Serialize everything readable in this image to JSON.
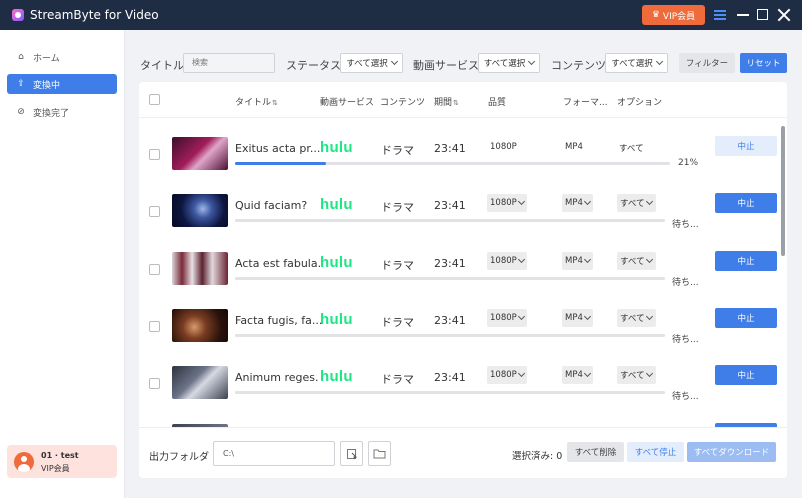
{
  "app": {
    "title": "StreamByte for Video",
    "vip_label": "VIP会員"
  },
  "sidebar": {
    "items": [
      {
        "label": "ホーム",
        "icon": "home-icon"
      },
      {
        "label": "変換中",
        "icon": "upload-icon"
      },
      {
        "label": "変換完了",
        "icon": "check-circle-icon"
      }
    ],
    "user": {
      "name": "01 · test",
      "plan": "VIP会員"
    }
  },
  "filters": {
    "title_label": "タイトル",
    "search_placeholder": "検索",
    "status_label": "ステータス",
    "status_value": "すべて選択",
    "service_label": "動画サービス",
    "service_value": "すべて選択",
    "content_label": "コンテンツ",
    "content_value": "すべて選択",
    "filter_button": "フィルター",
    "reset_button": "リセット"
  },
  "table": {
    "headers": {
      "title": "タイトル",
      "service": "動画サービス",
      "content": "コンテンツ",
      "duration": "期間",
      "quality": "品質",
      "format": "フォーマ...",
      "option": "オプション"
    },
    "rows": [
      {
        "title": "Exitus acta pr...",
        "service": "hulu",
        "content": "ドラマ",
        "duration": "23:41",
        "quality": "1080P",
        "format": "MP4",
        "option": "すべて",
        "status": "21%",
        "progress": 0.21,
        "action": "中止"
      },
      {
        "title": "Quid faciam?",
        "service": "hulu",
        "content": "ドラマ",
        "duration": "23:41",
        "quality": "1080P",
        "format": "MP4",
        "option": "すべて",
        "status": "待ち...",
        "progress": 0,
        "action": "中止"
      },
      {
        "title": "Acta est fabula.",
        "service": "hulu",
        "content": "ドラマ",
        "duration": "23:41",
        "quality": "1080P",
        "format": "MP4",
        "option": "すべて",
        "status": "待ち...",
        "progress": 0,
        "action": "中止"
      },
      {
        "title": "Facta fugis, fa...",
        "service": "hulu",
        "content": "ドラマ",
        "duration": "23:41",
        "quality": "1080P",
        "format": "MP4",
        "option": "すべて",
        "status": "待ち...",
        "progress": 0,
        "action": "中止"
      },
      {
        "title": "Animum reges.",
        "service": "hulu",
        "content": "ドラマ",
        "duration": "23:41",
        "quality": "1080P",
        "format": "MP4",
        "option": "すべて",
        "status": "待ち...",
        "progress": 0,
        "action": "中止"
      }
    ]
  },
  "footer": {
    "output_label": "出力フォルダ",
    "output_path": "C:\\",
    "selected_label": "選択済み: 0",
    "delete_all": "すべて削除",
    "stop_all": "すべて停止",
    "download_all": "すべてダウンロード"
  },
  "colors": {
    "accent": "#3f7ee8",
    "vip": "#f06b3b",
    "titlebar": "#1f2d44",
    "hulu": "#1ce783"
  }
}
